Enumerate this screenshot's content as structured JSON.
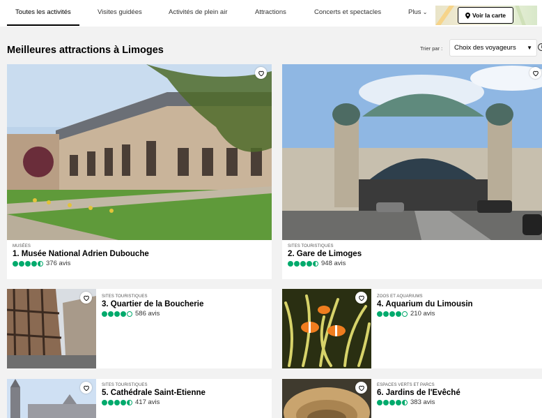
{
  "nav": {
    "tabs": [
      {
        "label": "Toutes les activités"
      },
      {
        "label": "Visites guidées"
      },
      {
        "label": "Activités de plein air"
      },
      {
        "label": "Attractions"
      },
      {
        "label": "Concerts et spectacles"
      },
      {
        "label": "Plus"
      }
    ],
    "map_button": "Voir la carte"
  },
  "header": {
    "title": "Meilleures attractions à Limoges",
    "sort_label": "Trier par :",
    "sort_value": "Choix des voyageurs"
  },
  "colors": {
    "rating_green": "#00aa6c",
    "background": "#f2f2f2"
  },
  "attractions": [
    {
      "category": "MUSÉES",
      "name": "1. Musée National Adrien Dubouche",
      "rating": 4.5,
      "reviews": "376 avis"
    },
    {
      "category": "SITES TOURISTIQUES",
      "name": "2. Gare de Limoges",
      "rating": 4.5,
      "reviews": "948 avis"
    },
    {
      "category": "SITES TOURISTIQUES",
      "name": "3. Quartier de la Boucherie",
      "rating": 4,
      "reviews": "586 avis"
    },
    {
      "category": "ZOOS ET AQUARIUMS",
      "name": "4. Aquarium du Limousin",
      "rating": 4,
      "reviews": "210 avis"
    },
    {
      "category": "SITES TOURISTIQUES",
      "name": "5. Cathédrale Saint-Etienne",
      "rating": 4.5,
      "reviews": "417 avis"
    },
    {
      "category": "ESPACES VERTS ET PARCS",
      "name": "6. Jardins de l'Evêché",
      "rating": 4.5,
      "reviews": "383 avis"
    }
  ]
}
